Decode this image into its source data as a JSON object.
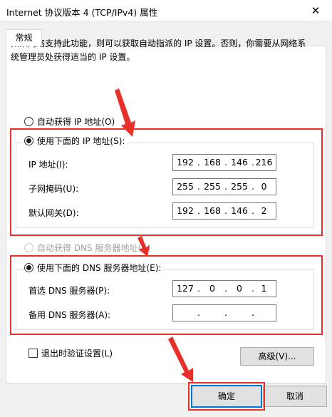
{
  "window": {
    "title": "Internet 协议版本 4 (TCP/IPv4) 属性",
    "close_glyph": "✕"
  },
  "tab": {
    "label": "常规"
  },
  "info_text": "如果网络支持此功能，则可以获取自动指派的 IP 设置。否则，你需要从网络系统管理员处获得适当的 IP 设置。",
  "ip_section": {
    "auto_label": "自动获得 IP 地址(O)",
    "manual_label": "使用下面的 IP 地址(S):",
    "manual_selected": true,
    "fields": [
      {
        "label": "IP 地址(I):",
        "octets": [
          "192",
          "168",
          "146",
          "216"
        ]
      },
      {
        "label": "子网掩码(U):",
        "octets": [
          "255",
          "255",
          "255",
          "0"
        ]
      },
      {
        "label": "默认网关(D):",
        "octets": [
          "192",
          "168",
          "146",
          "2"
        ]
      }
    ]
  },
  "dns_section": {
    "auto_label": "自动获得 DNS 服务器地址(B)",
    "auto_disabled": true,
    "manual_label": "使用下面的 DNS 服务器地址(E):",
    "manual_selected": true,
    "fields": [
      {
        "label": "首选 DNS 服务器(P):",
        "octets": [
          "127",
          "0",
          "0",
          "1"
        ]
      },
      {
        "label": "备用 DNS 服务器(A):",
        "octets": [
          "",
          "",
          "",
          ""
        ]
      }
    ]
  },
  "validate_on_exit": {
    "label": "退出时验证设置(L)",
    "checked": false
  },
  "buttons": {
    "advanced": "高级(V)...",
    "ok": "确定",
    "cancel": "取消"
  },
  "annotation_color": "#e8302a"
}
